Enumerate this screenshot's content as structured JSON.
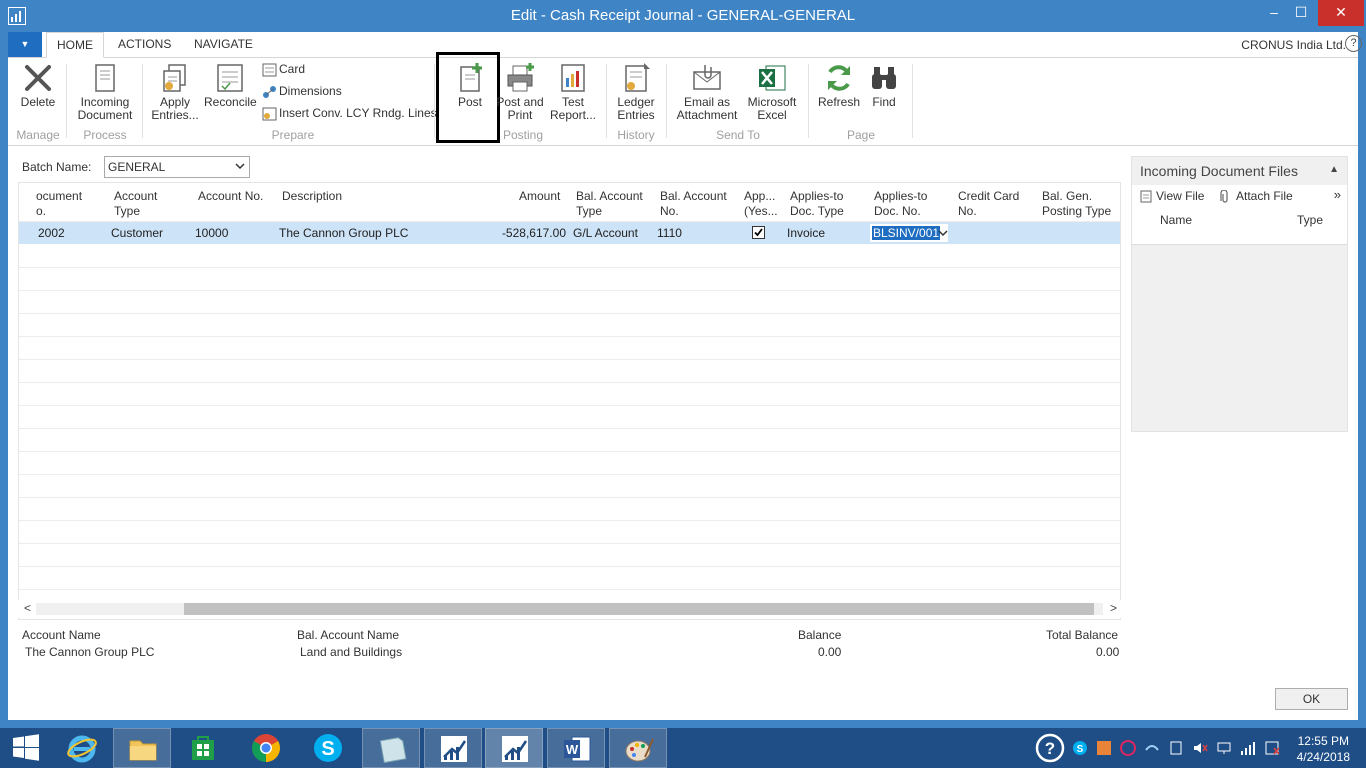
{
  "window": {
    "title": "Edit - Cash Receipt Journal - GENERAL-GENERAL",
    "minimize": "–",
    "maximize": "☐",
    "close": "✕"
  },
  "ribbon_tabs": {
    "menu": "▼",
    "home": "HOME",
    "actions": "ACTIONS",
    "navigate": "NAVIGATE",
    "company": "CRONUS India Ltd.",
    "help": "?"
  },
  "ribbon": {
    "delete": "Delete",
    "incoming_document_1": "Incoming",
    "incoming_document_2": "Document",
    "apply_entries_1": "Apply",
    "apply_entries_2": "Entries...",
    "reconcile": "Reconcile",
    "card": "Card",
    "dimensions": "Dimensions",
    "insert_conv": "Insert Conv. LCY Rndg. Lines",
    "post": "Post",
    "post_and_print_1": "Post and",
    "post_and_print_2": "Print",
    "test_report_1": "Test",
    "test_report_2": "Report...",
    "ledger_entries_1": "Ledger",
    "ledger_entries_2": "Entries",
    "email_1": "Email as",
    "email_2": "Attachment",
    "excel_1": "Microsoft",
    "excel_2": "Excel",
    "refresh": "Refresh",
    "find": "Find",
    "groups": {
      "manage": "Manage",
      "process": "Process",
      "prepare": "Prepare",
      "posting": "Posting",
      "history": "History",
      "send_to": "Send To",
      "page": "Page"
    }
  },
  "batch": {
    "label": "Batch Name:",
    "value": "GENERAL"
  },
  "grid": {
    "headers": {
      "doc_no_1": "ocument",
      "doc_no_2": "o.",
      "account_type_1": "Account",
      "account_type_2": "Type",
      "account_no": "Account No.",
      "description": "Description",
      "amount": "Amount",
      "bal_account_type_1": "Bal. Account",
      "bal_account_type_2": "Type",
      "bal_account_no_1": "Bal. Account",
      "bal_account_no_2": "No.",
      "applies_1": "App...",
      "applies_2": "(Yes...",
      "applies_to_doc_type_1": "Applies-to",
      "applies_to_doc_type_2": "Doc. Type",
      "applies_to_doc_no_1": "Applies-to",
      "applies_to_doc_no_2": "Doc. No.",
      "credit_card_1": "Credit Card",
      "credit_card_2": "No.",
      "bal_gen_1": "Bal. Gen.",
      "bal_gen_2": "Posting Type"
    },
    "row": {
      "doc_no": "2002",
      "account_type": "Customer",
      "account_no": "10000",
      "description": "The Cannon Group PLC",
      "amount": "-528,617.00",
      "bal_account_type": "G/L Account",
      "bal_account_no": "1110",
      "applies": true,
      "applies_to_doc_type": "Invoice",
      "applies_to_doc_no": "BLSINV/001"
    }
  },
  "footer": {
    "account_name_label": "Account Name",
    "account_name": "The Cannon Group PLC",
    "bal_account_name_label": "Bal. Account Name",
    "bal_account_name": "Land and Buildings",
    "balance_label": "Balance",
    "balance": "0.00",
    "total_balance_label": "Total Balance",
    "total_balance": "0.00"
  },
  "ok_button": "OK",
  "factbox": {
    "title": "Incoming Document Files",
    "view_file": "View File",
    "attach_file": "Attach File",
    "col_name": "Name",
    "col_type": "Type"
  },
  "taskbar": {
    "time": "12:55 PM",
    "date": "4/24/2018"
  },
  "colors": {
    "titlebar": "#3f85c6",
    "accent": "#1e6dc1",
    "selected_row": "#cde3f7",
    "taskbar": "#1f4e86"
  }
}
